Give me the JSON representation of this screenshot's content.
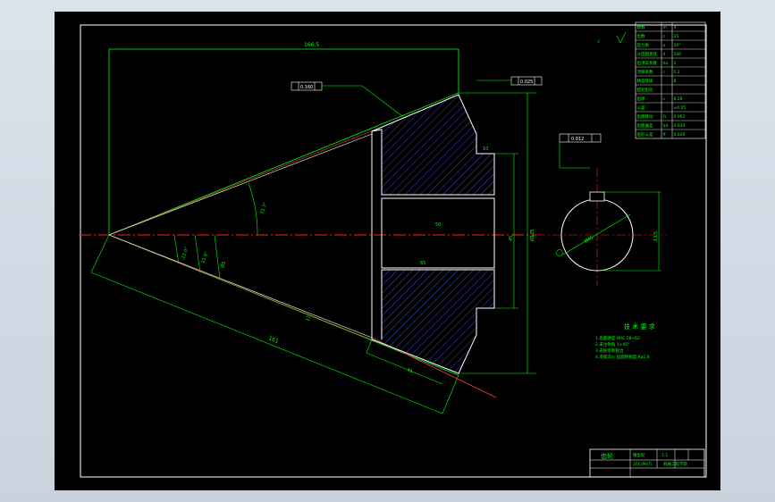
{
  "colors": {
    "background": "#000000",
    "frame": "#ffffff",
    "outline": "#ffffff",
    "dimension": "#00ff00",
    "centerline": "#ff0000",
    "hatch": "#4444ff",
    "annotation": "#00ff00"
  },
  "dimensions": {
    "overall_length": "166.5",
    "tol_cone": "0.160",
    "tol_runout": "0.025",
    "dim_10": "10",
    "dim_50": "50",
    "dim_45": "45",
    "dim_h5": "Ø5",
    "dia_label": "Ø125",
    "angle_1": "31.7°",
    "angle_2": "22.0°",
    "angle_3": "21.6°",
    "slant_161": "161",
    "bottom_45": "45",
    "face_12": "12",
    "key_tol": "0.012",
    "key_width": "13.5",
    "bore_dim": "Ø45",
    "small_65": "65"
  },
  "tech_requirements": {
    "title": "技 术 要 求",
    "lines": [
      "1.齿面硬度 HRC 58~62",
      "2.未注倒角 1×45°",
      "3.去除毛刺锐边",
      "4.渗碳淬火 齿面粗糙度 Ra1.6"
    ]
  },
  "title_block": {
    "title": "齿轮",
    "subtitle": "锥齿轮",
    "scale": "1:1",
    "material": "20CrMnTi",
    "school": "机械工程学院"
  },
  "param_table": [
    [
      "模数",
      "m",
      "4"
    ],
    [
      "齿数",
      "z",
      "25"
    ],
    [
      "压力角",
      "α",
      "20°"
    ],
    [
      "分度圆直径",
      "d",
      "100"
    ],
    [
      "齿顶高系数",
      "ha",
      "1"
    ],
    [
      "顶隙系数",
      "c",
      "0.2"
    ],
    [
      "精度等级",
      "",
      "8"
    ],
    [
      "配对齿轮",
      "",
      ""
    ],
    [
      "齿厚",
      "s",
      "6.28"
    ],
    [
      "公差",
      "",
      "±0.05"
    ],
    [
      "齿圈跳动",
      "Fr",
      "0.063"
    ],
    [
      "齿距偏差",
      "fpt",
      "0.020"
    ],
    [
      "齿形公差",
      "ff",
      "0.020"
    ]
  ]
}
